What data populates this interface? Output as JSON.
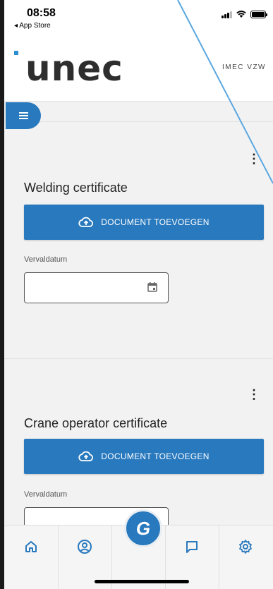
{
  "status_bar": {
    "time": "08:58",
    "back_label": "◂ App Store"
  },
  "header": {
    "logo_text": "unec",
    "org_name": "IMEC VZW"
  },
  "certificates": [
    {
      "title": "Welding certificate",
      "button_label": "DOCUMENT TOEVOEGEN",
      "date_label": "Vervaldatum",
      "date_value": ""
    },
    {
      "title": "Crane  operator certificate",
      "button_label": "DOCUMENT TOEVOEGEN",
      "date_label": "Vervaldatum",
      "date_value": ""
    }
  ],
  "bottom_nav": {
    "items": [
      {
        "icon": "home-icon"
      },
      {
        "icon": "account-circle-icon"
      },
      {
        "icon": "g-logo-icon"
      },
      {
        "icon": "chat-bubble-icon"
      },
      {
        "icon": "settings-gear-icon"
      }
    ],
    "center_letter": "G"
  },
  "colors": {
    "primary": "#2979be",
    "background": "#f2f2f2",
    "accent_logo": "#2a8fd0"
  }
}
